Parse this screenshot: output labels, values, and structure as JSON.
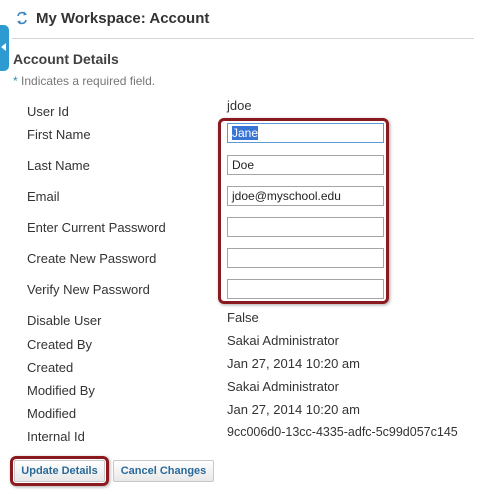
{
  "header": {
    "title": "My Workspace: Account",
    "icon": "refresh-arrows-icon",
    "tab_handle_icon": "collapse-arrow-icon",
    "accent_color": "#2d9bd2"
  },
  "section": {
    "heading": "Account Details",
    "required_star": "*",
    "required_note": "Indicates a required field."
  },
  "fields": {
    "user_id": {
      "label": "User Id",
      "value": "jdoe"
    },
    "first_name": {
      "label": "First Name",
      "value": "Jane"
    },
    "last_name": {
      "label": "Last Name",
      "value": "Doe"
    },
    "email": {
      "label": "Email",
      "value": "jdoe@myschool.edu"
    },
    "current_password": {
      "label": "Enter Current Password",
      "value": ""
    },
    "new_password": {
      "label": "Create New Password",
      "value": ""
    },
    "verify_password": {
      "label": "Verify New Password",
      "value": ""
    },
    "disable_user": {
      "label": "Disable User",
      "value": "False"
    },
    "created_by": {
      "label": "Created By",
      "value": "Sakai Administrator"
    },
    "created": {
      "label": "Created",
      "value": "Jan 27, 2014 10:20 am"
    },
    "modified_by": {
      "label": "Modified By",
      "value": "Sakai Administrator"
    },
    "modified": {
      "label": "Modified",
      "value": "Jan 27, 2014 10:20 am"
    },
    "internal_id": {
      "label": "Internal Id",
      "value": "9cc006d0-13cc-4335-adfc-5c99d057c145"
    }
  },
  "buttons": {
    "update": "Update Details",
    "cancel": "Cancel Changes"
  },
  "highlight_color": "#8b1a1f"
}
